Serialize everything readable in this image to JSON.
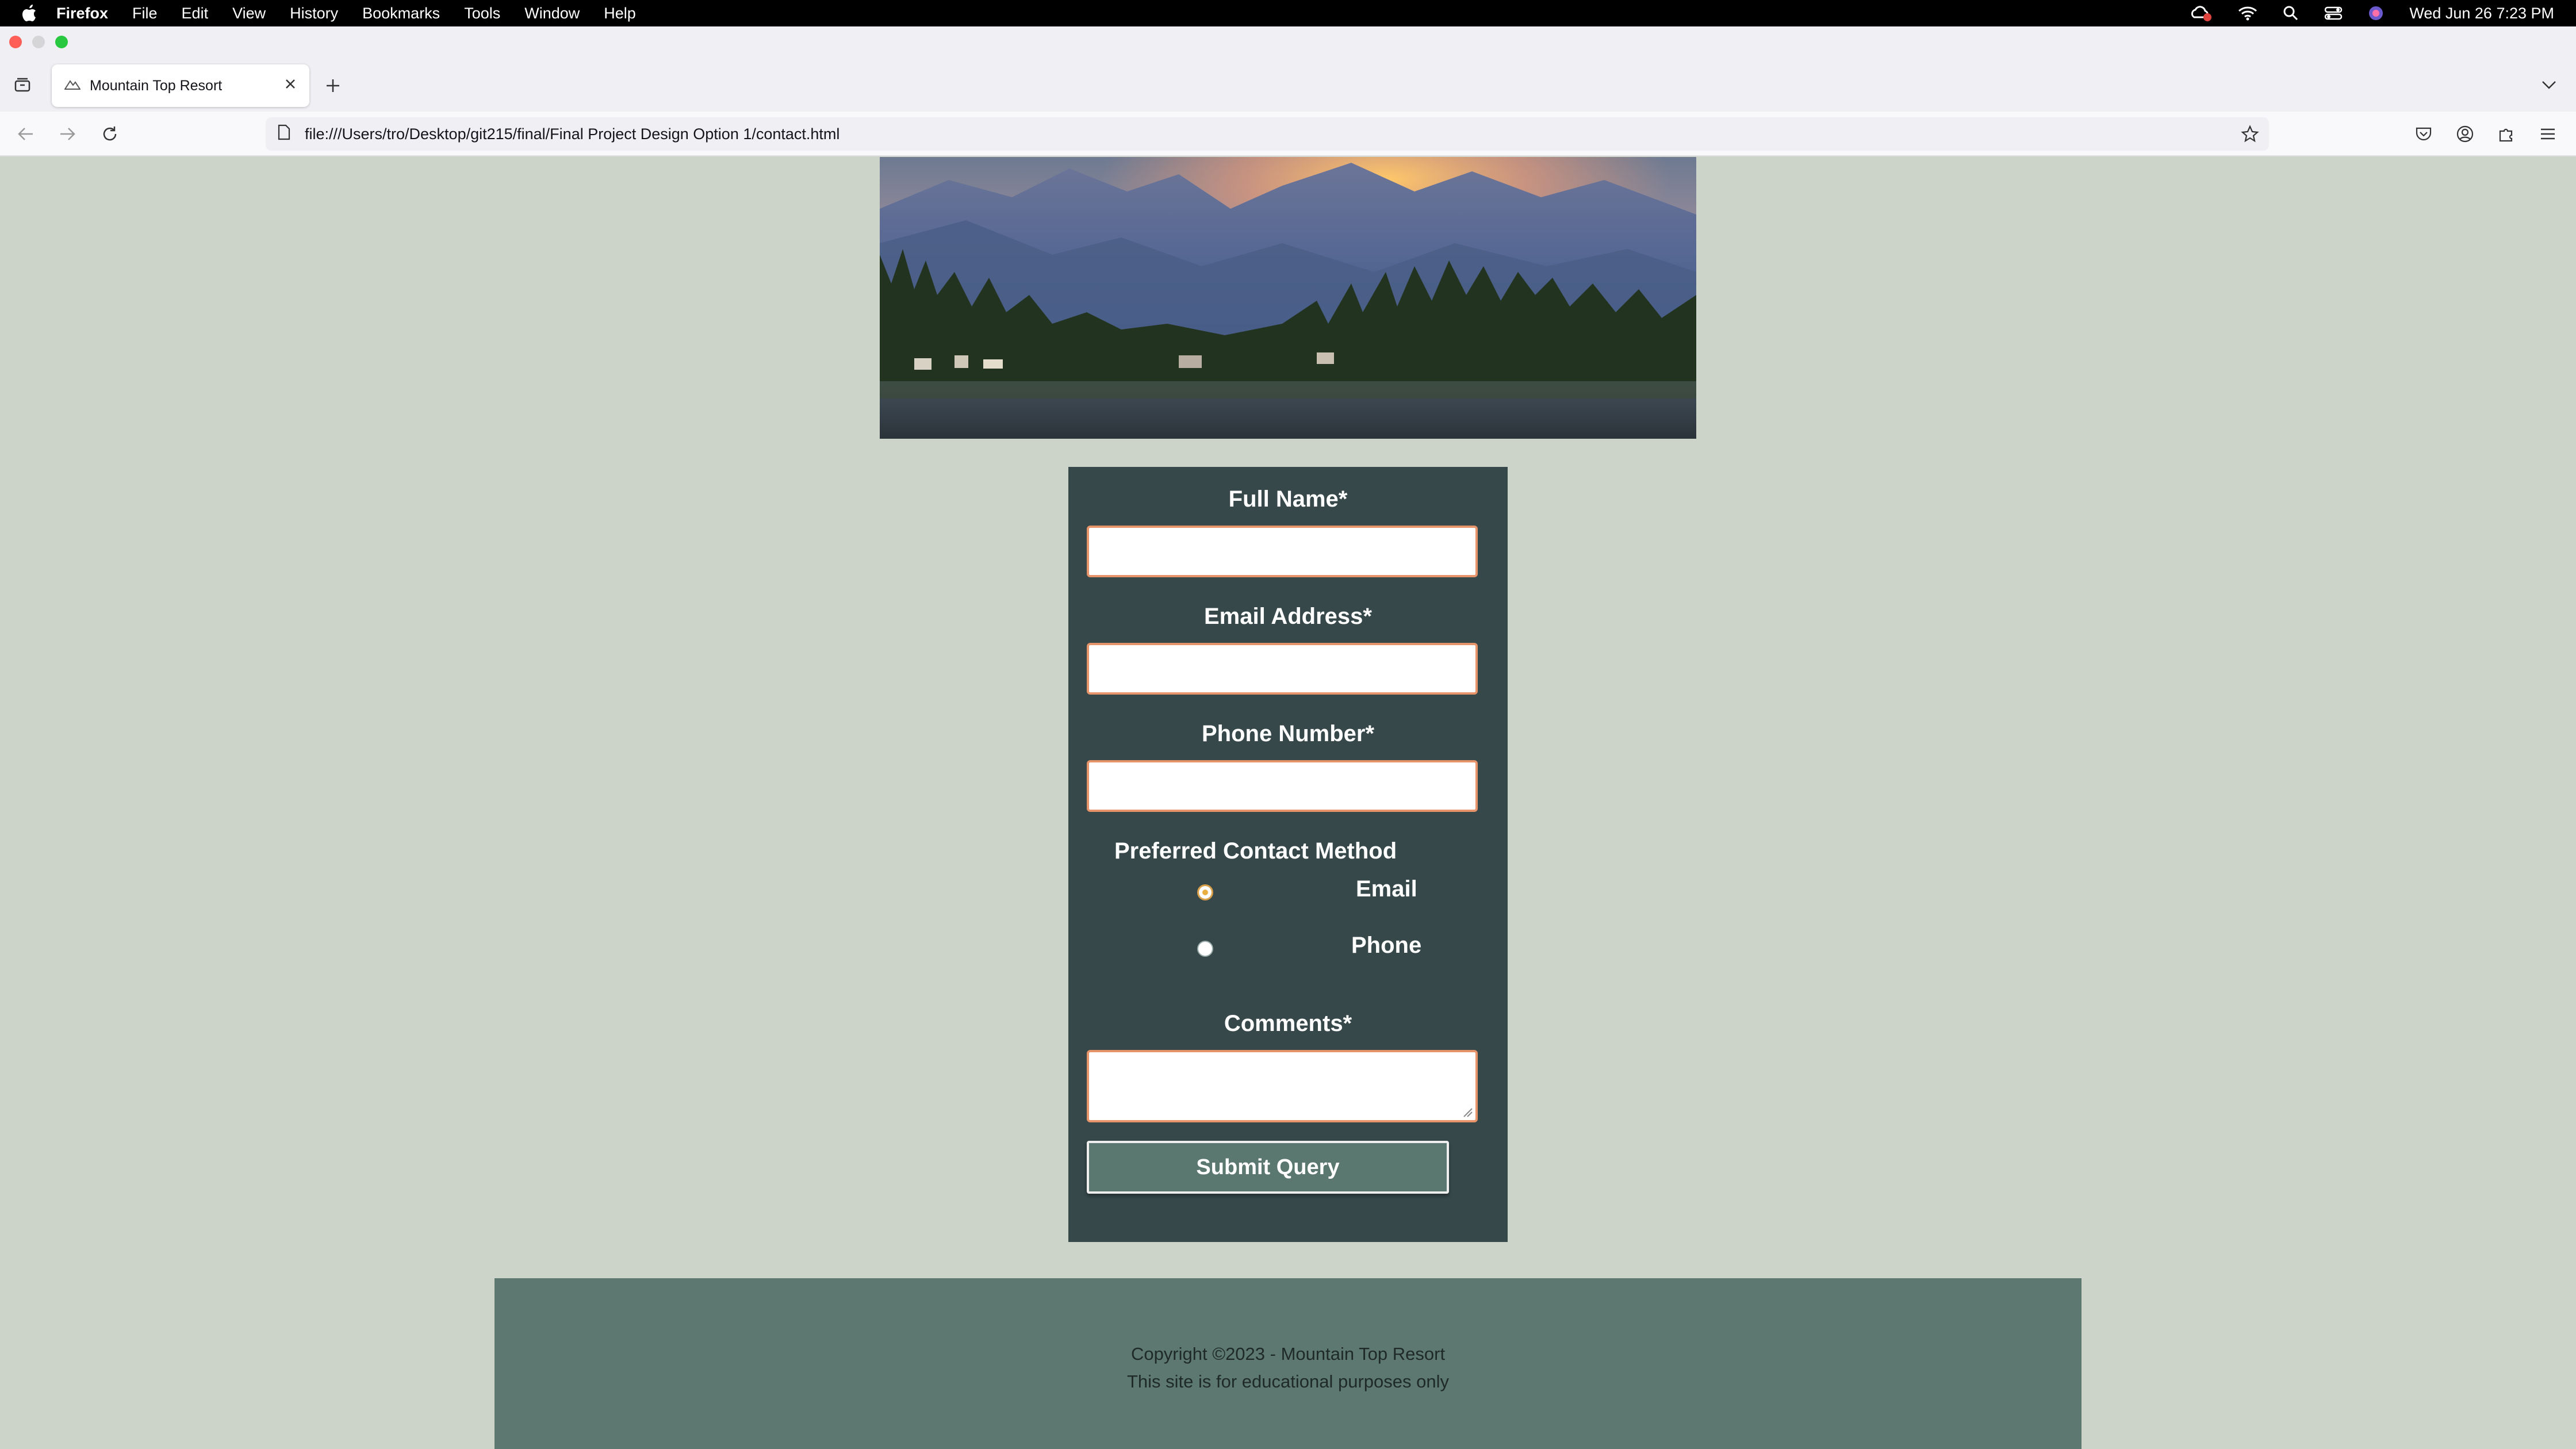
{
  "menubar": {
    "app": "Firefox",
    "items": [
      "File",
      "Edit",
      "View",
      "History",
      "Bookmarks",
      "Tools",
      "Window",
      "Help"
    ],
    "clock": "Wed Jun 26  7:23 PM"
  },
  "browser": {
    "tab_title": "Mountain Top Resort",
    "url": "file:///Users/tro/Desktop/git215/final/Final Project Design Option 1/contact.html"
  },
  "form": {
    "full_name_label": "Full Name*",
    "email_label": "Email Address*",
    "phone_label": "Phone Number*",
    "contact_method_label": "Preferred Contact Method",
    "contact_options": [
      "Email",
      "Phone"
    ],
    "selected_option": "Email",
    "comments_label": "Comments*",
    "submit_label": "Submit Query"
  },
  "footer": {
    "copyright": "Copyright ©2023 - Mountain Top Resort",
    "note": "This site is for educational purposes only"
  },
  "colors": {
    "page_bg": "#ccd3c8",
    "form_bg": "#37484a",
    "input_border": "#e7946a",
    "button_bg": "#5b7870",
    "footer_bg": "#5c7870"
  }
}
